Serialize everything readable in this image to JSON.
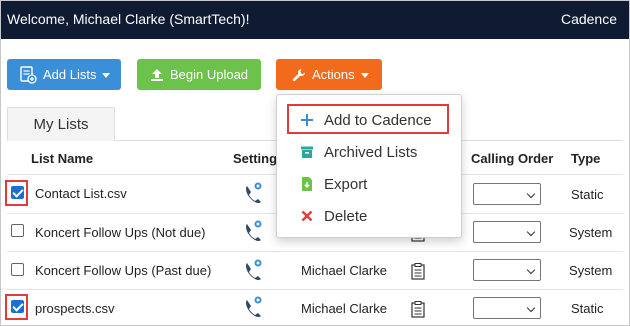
{
  "header": {
    "welcome": "Welcome, Michael Clarke (SmartTech)!",
    "brand": "Cadence"
  },
  "toolbar": {
    "add_lists_label": "Add Lists",
    "begin_upload_label": "Begin Upload",
    "actions_label": "Actions"
  },
  "tabs": [
    {
      "label": "My Lists"
    }
  ],
  "table": {
    "columns": [
      "List Name",
      "Setting",
      "Calling Order",
      "Type"
    ],
    "rows": [
      {
        "name": "Contact List.csv",
        "owner": "",
        "type": "Static",
        "checked": true,
        "highlighted": true
      },
      {
        "name": "Koncert Follow Ups (Not due)",
        "owner": "",
        "type": "System",
        "checked": false,
        "highlighted": false
      },
      {
        "name": "Koncert Follow Ups (Past due)",
        "owner": "Michael Clarke",
        "type": "System",
        "checked": false,
        "highlighted": false
      },
      {
        "name": "prospects.csv",
        "owner": "Michael Clarke",
        "type": "Static",
        "checked": true,
        "highlighted": true
      }
    ]
  },
  "actions_menu": {
    "items": [
      {
        "label": "Add to Cadence",
        "icon": "plus-icon",
        "highlighted": true
      },
      {
        "label": "Archived Lists",
        "icon": "archive-icon",
        "highlighted": false
      },
      {
        "label": "Export",
        "icon": "export-file-icon",
        "highlighted": false
      },
      {
        "label": "Delete",
        "icon": "delete-x-icon",
        "highlighted": false
      }
    ]
  },
  "colors": {
    "topbar": "#0f1a33",
    "primary_blue": "#3b8fd8",
    "success_green": "#6cc24a",
    "action_orange": "#f26a1b",
    "highlight_red": "#e03c3c"
  }
}
